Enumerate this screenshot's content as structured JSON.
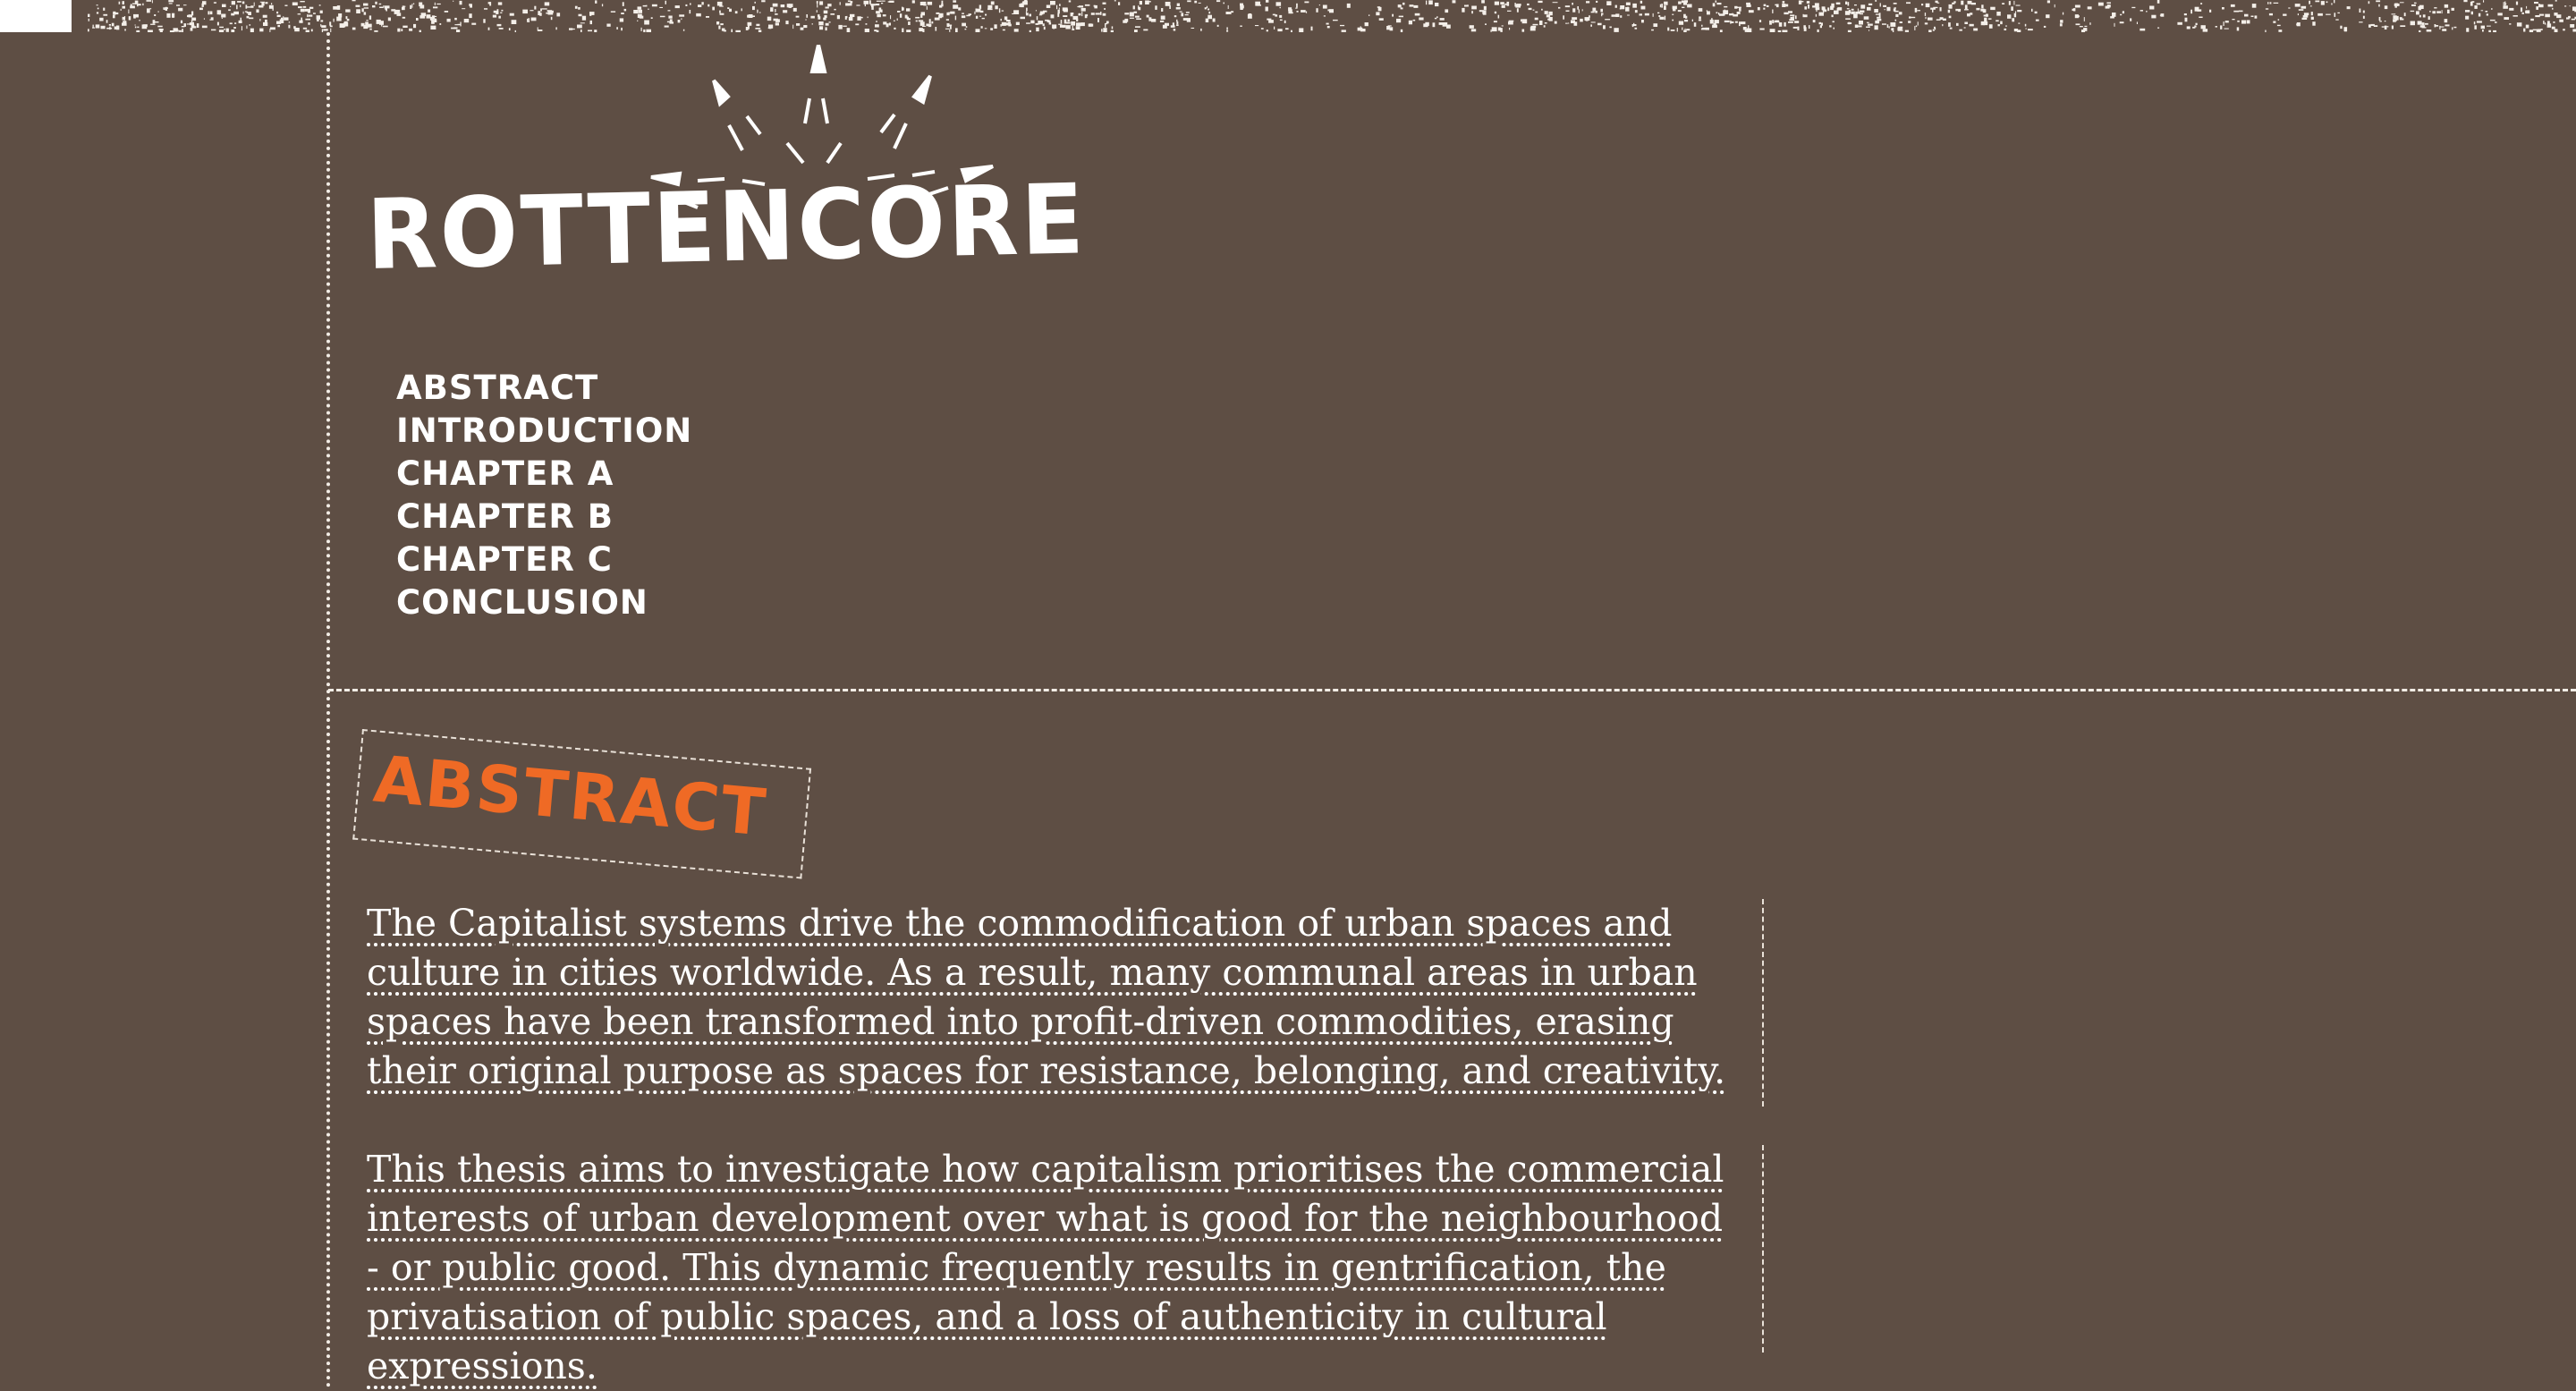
{
  "site": {
    "logo_text": "ROTTENCORE"
  },
  "nav": {
    "items": [
      "ABSTRACT",
      "INTRODUCTION",
      "CHAPTER A",
      "CHAPTER B",
      "CHAPTER C",
      "CONCLUSION"
    ]
  },
  "section": {
    "heading": "ABSTRACT",
    "paragraphs": [
      "The Capitalist systems drive the commodification of urban spaces and culture in cities worldwide. As a result, many communal areas in urban spaces have been transformed into profit-driven commodities, erasing their original purpose as spaces for resistance, belonging, and creativity.",
      "This thesis aims to investigate how capitalism prioritises the commercial interests of urban development over what is good for the neighbourhood - or public good. This dynamic frequently results in gentrification, the privatisation of public spaces, and a loss of authenticity in cultural expressions."
    ]
  },
  "colors": {
    "background": "#5e4e44",
    "accent": "#ef6a25",
    "text": "#ffffff"
  }
}
